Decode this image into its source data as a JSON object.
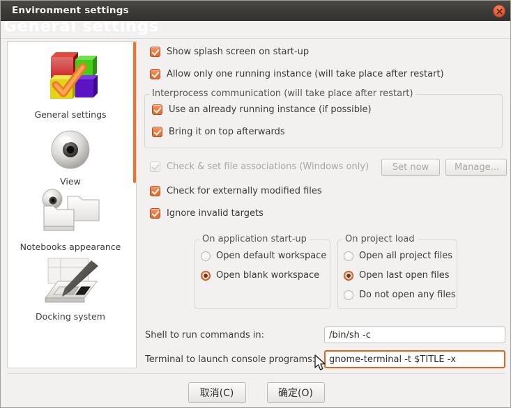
{
  "window": {
    "title": "Environment settings",
    "close_icon": "close-icon"
  },
  "page": {
    "header_title": "General settings"
  },
  "sidebar": {
    "items": [
      {
        "label": "General settings",
        "icon": "colored-cubes-check-icon"
      },
      {
        "label": "View",
        "icon": "eye-sphere-icon"
      },
      {
        "label": "Notebooks appearance",
        "icon": "eye-folders-icon"
      },
      {
        "label": "Docking system",
        "icon": "palette-brush-icon"
      }
    ]
  },
  "main": {
    "checkboxes": {
      "splash": {
        "label": "Show splash screen on start-up",
        "checked": true,
        "enabled": true
      },
      "single_instance": {
        "label": "Allow only one running instance (will take place after restart)",
        "checked": true,
        "enabled": true
      },
      "file_assoc": {
        "label": "Check & set file associations (Windows only)",
        "checked": true,
        "enabled": false
      },
      "check_external": {
        "label": "Check for externally modified files",
        "checked": true,
        "enabled": true
      },
      "ignore_invalid": {
        "label": "Ignore invalid targets",
        "checked": true,
        "enabled": true
      }
    },
    "ipc_group": {
      "title": "Interprocess communication (will take place after restart)",
      "items": [
        {
          "label": "Use an already running instance (if possible)",
          "checked": true
        },
        {
          "label": "Bring it on top afterwards",
          "checked": true
        }
      ]
    },
    "assoc_buttons": {
      "set_now": "Set now",
      "manage": "Manage..."
    },
    "startup_group": {
      "title": "On application start-up",
      "options": [
        {
          "label": "Open default workspace",
          "selected": false
        },
        {
          "label": "Open blank workspace",
          "selected": true
        }
      ]
    },
    "project_group": {
      "title": "On project load",
      "options": [
        {
          "label": "Open all project files",
          "selected": false
        },
        {
          "label": "Open last open files",
          "selected": true
        },
        {
          "label": "Do not open any files",
          "selected": false
        }
      ]
    },
    "fields": {
      "shell": {
        "label": "Shell to run commands in:",
        "value": "/bin/sh -c",
        "focused": false
      },
      "terminal": {
        "label": "Terminal to launch console programs:",
        "value": "gnome-terminal -t $TITLE -x",
        "focused": true
      }
    }
  },
  "footer": {
    "cancel_label": "取消(C)",
    "ok_label": "确定(O)"
  },
  "colors": {
    "accent_orange": "#e8762d",
    "titlebar": "#3c3b38",
    "panel_bg": "#f2f1f0",
    "focus_border": "#e1651f"
  }
}
